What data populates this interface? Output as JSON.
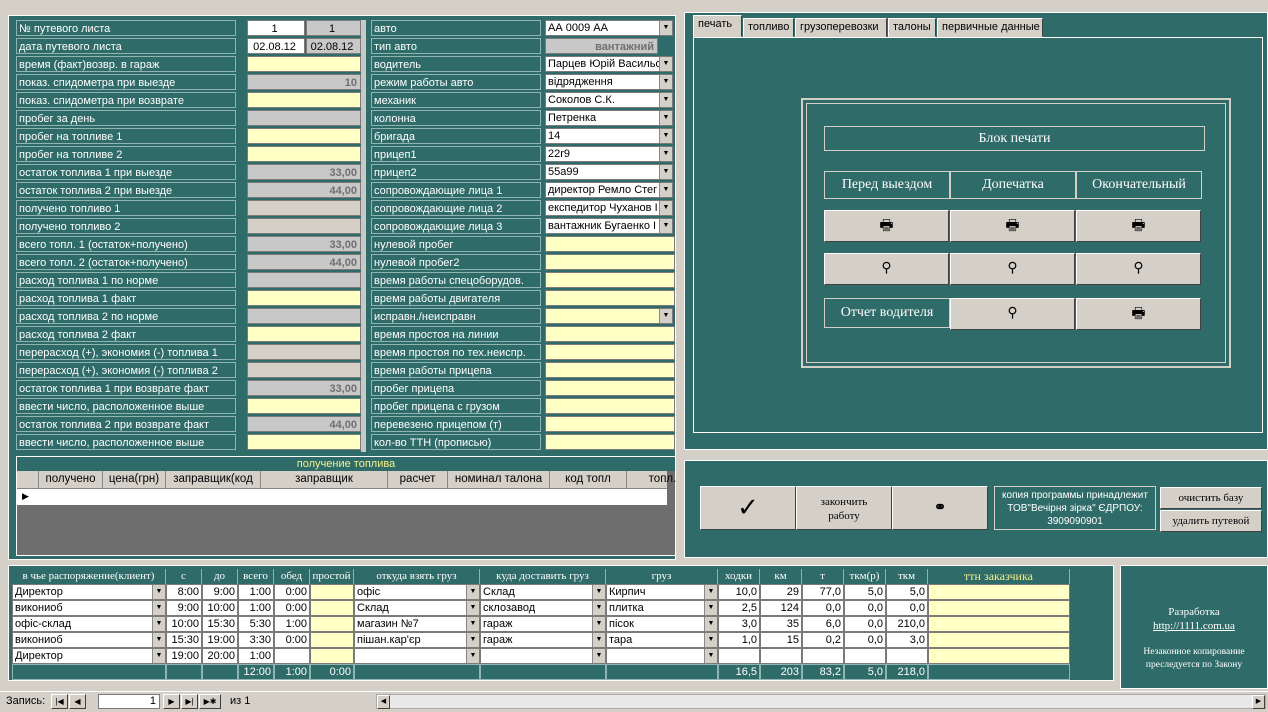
{
  "left_labels": [
    "№ путевого листа",
    "дата путевого листа",
    "время (факт)возвр. в гараж",
    "показ. спидометра при выезде",
    "показ. спидометра при возврате",
    "пробег за день",
    "пробег на топливе 1",
    "пробег на топливе 2",
    "остаток  топлива 1 при выезде",
    "остаток топлива 2 при выезде",
    "получено топливо 1",
    "получено топливо 2",
    "всего топл. 1 (остаток+получено)",
    "всего топл. 2 (остаток+получено)",
    "расход топлива 1 по норме",
    "расход топлива 1 факт",
    "расход топлива 2 по норме",
    "расход топлива 2 факт",
    "перерасход (+), экономия (-) топлива 1",
    "перерасход (+), экономия (-) топлива 2",
    "остаток топлива 1 при возврате факт",
    "ввести число, расположенное выше",
    "остаток топлива 2 при возврате факт",
    "ввести число, расположенное выше"
  ],
  "left_values": [
    {
      "v": "1",
      "v2": "1"
    },
    {
      "v": "02.08.12",
      "v2": "02.08.12"
    },
    {
      "v": ""
    },
    {
      "v": "10"
    },
    {
      "v": ""
    },
    {
      "v": ""
    },
    {
      "v": ""
    },
    {
      "v": ""
    },
    {
      "v": "33,00"
    },
    {
      "v": "44,00"
    },
    {
      "v": ""
    },
    {
      "v": ""
    },
    {
      "v": "33,00"
    },
    {
      "v": "44,00"
    },
    {
      "v": ""
    },
    {
      "v": ""
    },
    {
      "v": ""
    },
    {
      "v": ""
    },
    {
      "v": ""
    },
    {
      "v": ""
    },
    {
      "v": "33,00"
    },
    {
      "v": ""
    },
    {
      "v": "44,00"
    },
    {
      "v": ""
    }
  ],
  "mid_labels": [
    "авто",
    "тип авто",
    "водитель",
    "режим работы авто",
    "механик",
    "колонна",
    "бригада",
    "прицеп1",
    "прицеп2",
    "сопровождающие  лица 1",
    "сопровождающие лица 2",
    "сопровождающие лица 3",
    "нулевой пробег",
    "нулевой пробег2",
    "время работы спецоборудов.",
    "время работы двигателя",
    "исправн./неисправн",
    "время простоя на линии",
    "время простоя по тех.неиспр.",
    "время работы прицепа",
    "пробег прицепа",
    "пробег прицепа с грузом",
    "перевезено прицепом (т)",
    "кол-во ТТН (прописью)"
  ],
  "mid_values": [
    "АА 0009 АА",
    "вантажний",
    "Парцев Юрій Васильо",
    "відрядження",
    "Соколов С.К.",
    "Петренка",
    "14",
    "22r9",
    "55a99",
    "директор Ремло Стег",
    "експедитор Чуханов І",
    "вантажник Бугаенко І",
    "",
    "",
    "",
    "",
    "",
    "",
    "",
    "",
    "",
    "",
    "",
    ""
  ],
  "fuel_table": {
    "title": "получение топлива",
    "columns": [
      "получено",
      "цена(грн)",
      "заправщик(код",
      "заправщик",
      "расчет",
      "номинал талона",
      "код топл",
      "топл."
    ]
  },
  "tabs": [
    "печать",
    "топливо",
    "грузоперевозки",
    "талоны",
    "первичные данные"
  ],
  "print_block": {
    "title": "Блок печати",
    "before": "Перед выездом",
    "reprint": "Допечатка",
    "final": "Окончательный",
    "driver_report": "Отчет водителя"
  },
  "actions": {
    "finish": "закончить работу",
    "copy_note": "копия программы принадлежит ТОВ\"Вечірня зірка\" ЄДРПОУ: 3909090901",
    "clear_db": "очистить базу",
    "delete_sheet": "удалить путевой"
  },
  "trips": {
    "columns": [
      "в чье распоряжение(клиент)",
      "с",
      "до",
      "всего",
      "обед",
      "простой",
      "откуда взять груз",
      "куда доставить груз",
      "груз",
      "ходки",
      "км",
      "т",
      "ткм(р)",
      "ткм",
      "ттн заказчика"
    ],
    "rows": [
      [
        "Директор",
        "8:00",
        "9:00",
        "1:00",
        "0:00",
        "",
        "офіс",
        "Склад",
        "Кирпич",
        "10,0",
        "29",
        "77,0",
        "5,0",
        "5,0",
        ""
      ],
      [
        "викониоб",
        "9:00",
        "10:00",
        "1:00",
        "0:00",
        "",
        "Склад",
        "склозавод",
        "плитка",
        "2,5",
        "124",
        "0,0",
        "0,0",
        "0,0",
        ""
      ],
      [
        "офіс-склад",
        "10:00",
        "15:30",
        "5:30",
        "1:00",
        "",
        "магазин №7",
        "гараж",
        "пісок",
        "3,0",
        "35",
        "6,0",
        "0,0",
        "210,0",
        ""
      ],
      [
        "викониоб",
        "15:30",
        "19:00",
        "3:30",
        "0:00",
        "",
        "пішан.кар'єр",
        "гараж",
        "тара",
        "1,0",
        "15",
        "0,2",
        "0,0",
        "3,0",
        ""
      ],
      [
        "Директор",
        "19:00",
        "20:00",
        "1:00",
        "",
        "",
        "",
        "",
        "",
        "",
        "",
        "",
        "",
        "",
        ""
      ]
    ],
    "totals": [
      "",
      "",
      "",
      "12:00",
      "1:00",
      "0:00",
      "",
      "",
      "",
      "16,5",
      "203",
      "83,2",
      "5,0",
      "218,0",
      ""
    ]
  },
  "dev": {
    "title": "Разработка",
    "url": "http://1111.com.ua",
    "warning": "Незаконное копирование преследуется по Закону"
  },
  "nav": {
    "label": "Запись:",
    "current": "1",
    "of": "из  1"
  }
}
